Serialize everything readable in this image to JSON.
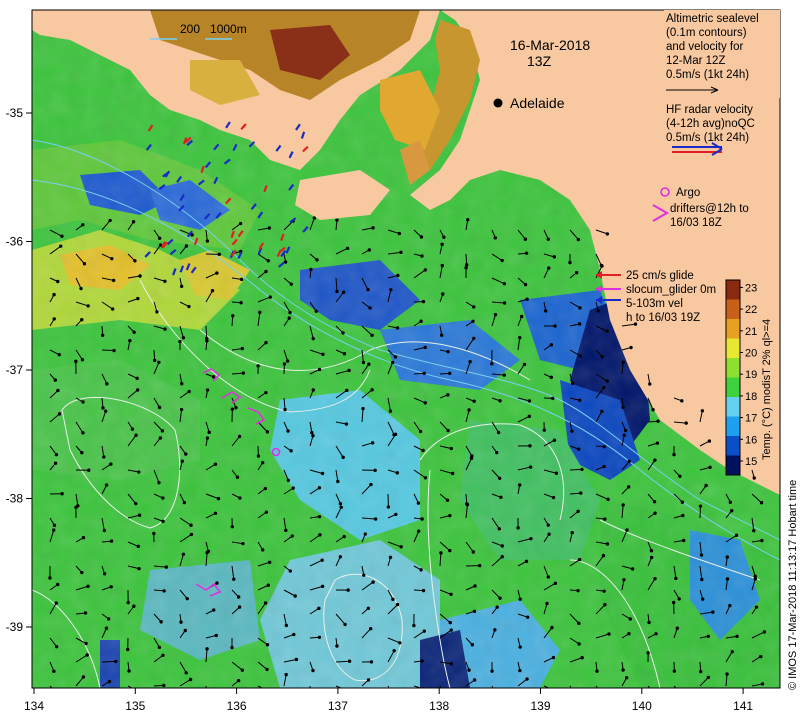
{
  "map": {
    "date": "16-Mar-2018",
    "time": "13Z",
    "depth_legend": "200   1000m",
    "city": "Adelaide",
    "lon_ticks": [
      "134",
      "135",
      "136",
      "137",
      "138",
      "139",
      "140",
      "141"
    ],
    "lat_ticks": [
      "-35",
      "-36",
      "-37",
      "-38",
      "-39"
    ],
    "legend_altimetric": [
      "Altimetric sealevel",
      "(0.1m contours)",
      "and velocity for",
      "12-Mar 12Z",
      "0.5m/s (1kt 24h)"
    ],
    "legend_hf": [
      "HF radar velocity",
      "(4-12h avg)noQC",
      "0.5m/s (1kt 24h)"
    ],
    "legend_argo": [
      "Argo",
      "drifters@12h to",
      "16/03 18Z"
    ],
    "legend_glider": [
      "25 cm/s glide",
      "slocum_glider 0m",
      "5-103m vel",
      "h to 16/03 19Z"
    ],
    "colorbar": {
      "label": "Temp. (°C) modisT 2% ql>=4",
      "ticks": [
        "15",
        "16",
        "17",
        "18",
        "19",
        "20",
        "21",
        "22",
        "23"
      ],
      "colors": [
        "#00125e",
        "#0a4fc8",
        "#1ea0f0",
        "#66d0f0",
        "#3ed13e",
        "#8ee030",
        "#e8e830",
        "#e8a020",
        "#c8601a",
        "#8a2a10"
      ]
    },
    "credit": "© IMOS 17-Mar-2018 11:13:17 Hobart time",
    "colors": {
      "land": "#f8c8a0",
      "ocean_mid": "#3cc43c",
      "ocean_cold": "#1a7ad8",
      "contour": "#e8f0e8"
    }
  }
}
